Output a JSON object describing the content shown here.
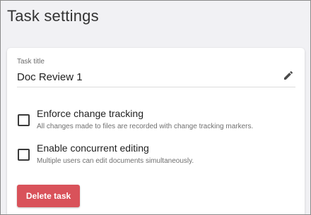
{
  "page": {
    "title": "Task settings"
  },
  "task_title_field": {
    "label": "Task title",
    "value": "Doc Review 1",
    "edit_icon": "pencil-icon"
  },
  "options": [
    {
      "title": "Enforce change tracking",
      "description": "All changes made to files are recorded with change tracking markers.",
      "checked": false
    },
    {
      "title": "Enable concurrent editing",
      "description": "Multiple users can edit documents simultaneously.",
      "checked": false
    }
  ],
  "actions": {
    "delete_label": "Delete task",
    "delete_color": "#d9525a"
  }
}
